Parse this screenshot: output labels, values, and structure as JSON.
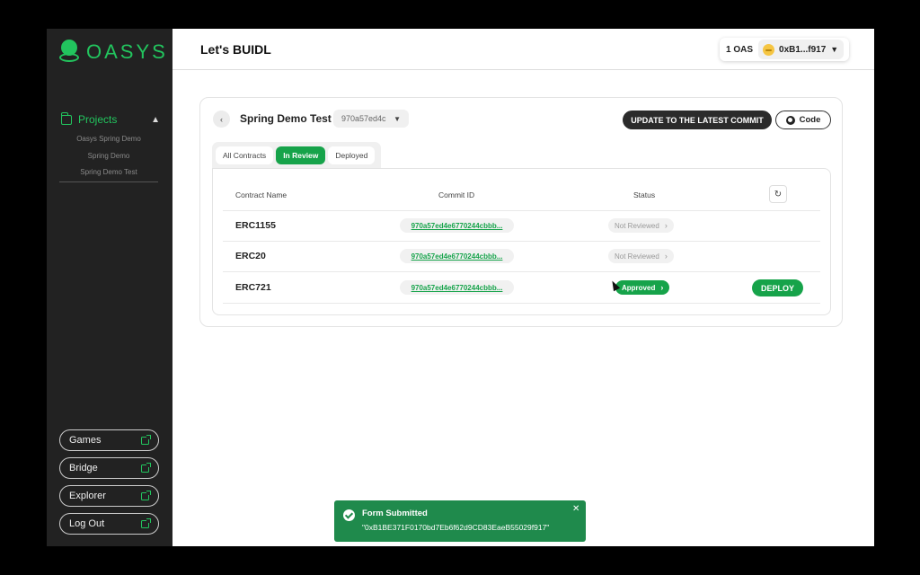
{
  "brand": {
    "name": "OASYS",
    "color": "#22c55e"
  },
  "header": {
    "title": "Let's BUIDL"
  },
  "wallet": {
    "balance": "1 OAS",
    "address": "0xB1...f917"
  },
  "sidebar": {
    "projects_label": "Projects",
    "sub_items": [
      "Oasys Spring Demo",
      "Spring Demo",
      "Spring Demo Test"
    ],
    "buttons": [
      "Games",
      "Bridge",
      "Explorer",
      "Log Out"
    ]
  },
  "project": {
    "name": "Spring Demo Test",
    "commit_short": "970a57ed4c",
    "update_label": "UPDATE TO THE LATEST COMMIT",
    "code_label": "Code"
  },
  "tabs": [
    "All Contracts",
    "In Review",
    "Deployed"
  ],
  "active_tab": "In Review",
  "table": {
    "headers": [
      "Contract Name",
      "Commit ID",
      "Status"
    ],
    "rows": [
      {
        "name": "ERC1155",
        "commit": "970a57ed4e6770244cbbb...",
        "status": "Not Reviewed"
      },
      {
        "name": "ERC20",
        "commit": "970a57ed4e6770244cbbb...",
        "status": "Not Reviewed"
      },
      {
        "name": "ERC721",
        "commit": "970a57ed4e6770244cbbb...",
        "status": "Approved",
        "action": "DEPLOY"
      }
    ]
  },
  "toast": {
    "title": "Form Submitted",
    "message": "\"0xB1BE371F0170bd7Eb6f62d9CD83EaeB55029f917\""
  }
}
